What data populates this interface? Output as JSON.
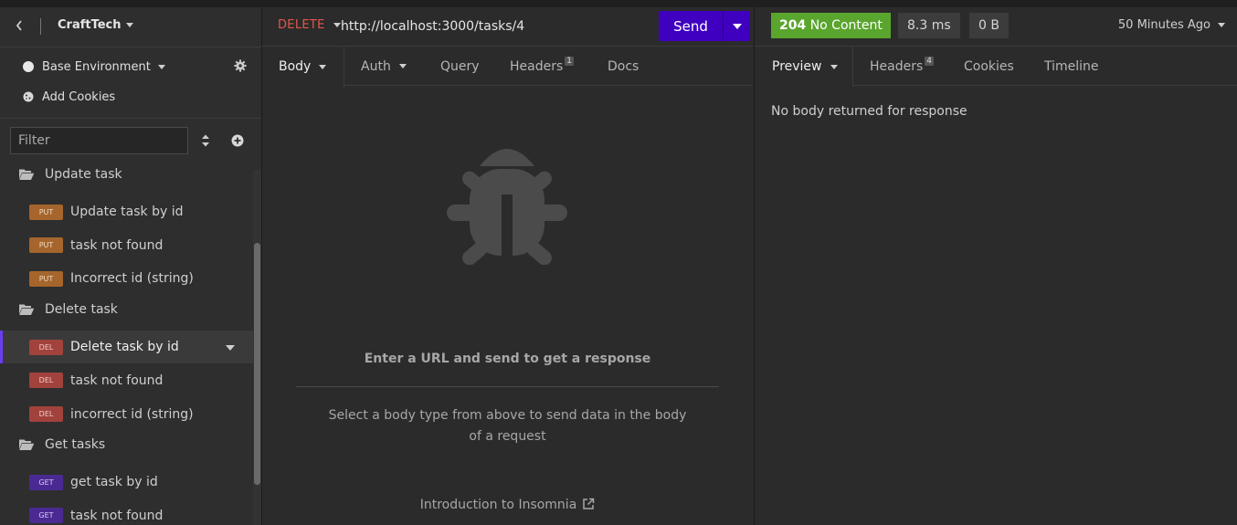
{
  "workspace": {
    "name": "CraftTech"
  },
  "environment": {
    "label": "Base Environment"
  },
  "cookies": {
    "label": "Add Cookies"
  },
  "filter": {
    "placeholder": "Filter"
  },
  "tree": [
    {
      "kind": "folder",
      "label": "Update task"
    },
    {
      "kind": "request",
      "method": "PUT",
      "label": "Update task by id"
    },
    {
      "kind": "request",
      "method": "PUT",
      "label": "task not found"
    },
    {
      "kind": "request",
      "method": "PUT",
      "label": "Incorrect id (string)"
    },
    {
      "kind": "folder",
      "label": "Delete task"
    },
    {
      "kind": "request",
      "method": "DEL",
      "label": "Delete task by id",
      "active": true
    },
    {
      "kind": "request",
      "method": "DEL",
      "label": "task not found"
    },
    {
      "kind": "request",
      "method": "DEL",
      "label": "incorrect id (string)"
    },
    {
      "kind": "folder",
      "label": "Get tasks"
    },
    {
      "kind": "request",
      "method": "GET",
      "label": "get task by id"
    },
    {
      "kind": "request",
      "method": "GET",
      "label": "task not found"
    }
  ],
  "request": {
    "method": "DELETE",
    "url": "http://localhost:3000/tasks/4",
    "send_label": "Send",
    "tabs": {
      "body": "Body",
      "auth": "Auth",
      "query": "Query",
      "headers": "Headers",
      "headers_count": "1",
      "docs": "Docs"
    },
    "empty_title": "Enter a URL and send to get a response",
    "empty_desc": "Select a body type from above to send data in the body of a request",
    "intro_link": "Introduction to Insomnia"
  },
  "response": {
    "status_code": "204",
    "status_text": "No Content",
    "time": "8.3 ms",
    "size": "0 B",
    "time_ago": "50 Minutes Ago",
    "tabs": {
      "preview": "Preview",
      "headers": "Headers",
      "headers_count": "4",
      "cookies": "Cookies",
      "timeline": "Timeline"
    },
    "body_text": "No body returned for response"
  },
  "colors": {
    "accent": "#4000bf",
    "status_ok": "#5aa52d",
    "method_delete": "#e2574c"
  }
}
